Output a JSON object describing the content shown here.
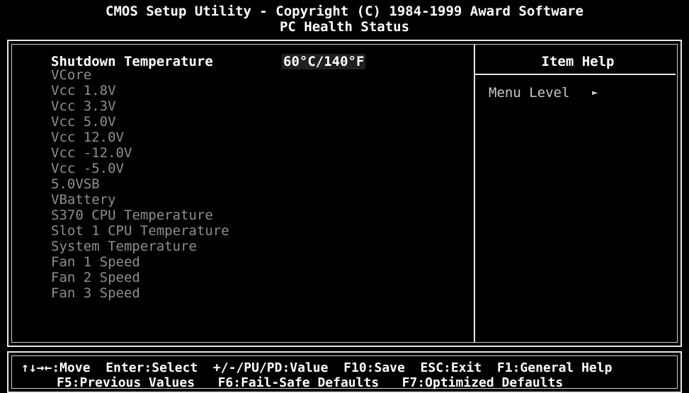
{
  "header": {
    "title": "CMOS Setup Utility - Copyright (C) 1984-1999 Award Software",
    "subtitle": "PC Health Status"
  },
  "menu": {
    "items": [
      "Shutdown Temperature",
      "VCore",
      "Vcc 1.8V",
      "Vcc 3.3V",
      "Vcc 5.0V",
      "Vcc 12.0V",
      "Vcc -12.0V",
      "Vcc -5.0V",
      "5.0VSB",
      "VBattery",
      "S370 CPU Temperature",
      "Slot 1 CPU Temperature",
      "System Temperature",
      "Fan 1 Speed",
      "Fan 2 Speed",
      "Fan 3 Speed"
    ],
    "selected_value": "60°C/140°F"
  },
  "help": {
    "title": "Item Help",
    "menu_level_label": "Menu Level",
    "menu_level_arrow": "►"
  },
  "footer": {
    "line1": "↑↓→←:Move  Enter:Select  +/-/PU/PD:Value  F10:Save  ESC:Exit  F1:General Help",
    "line2": "F5:Previous Values   F6:Fail-Safe Defaults   F7:Optimized Defaults"
  },
  "colors": {
    "background": "#000000",
    "text_active": "#ffffff",
    "text_disabled": "#8f8f8f",
    "border": "#e6e6e6"
  }
}
